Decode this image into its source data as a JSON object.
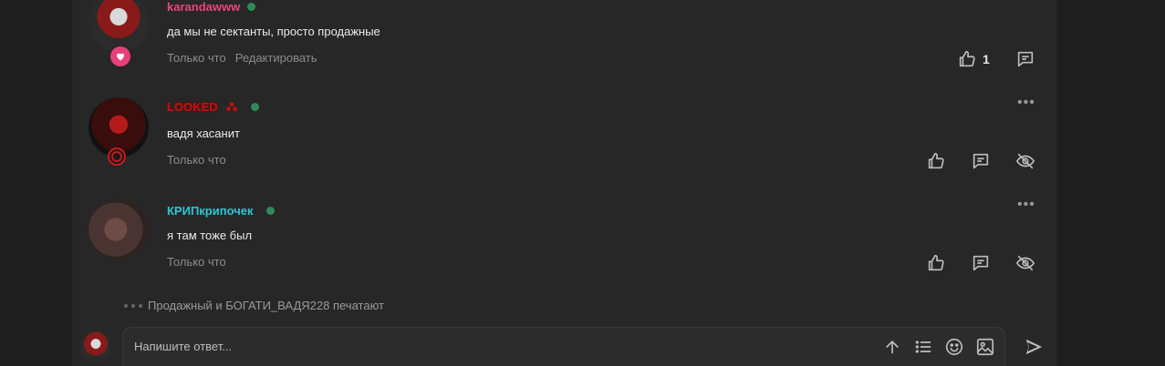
{
  "comments": [
    {
      "username": "karandawww",
      "text": "да мы не сектанты, просто продажные",
      "time": "Только что",
      "edit_label": "Редактировать",
      "likes": "1",
      "badge": "heart-badge",
      "colors": {
        "username": "#e8457d",
        "online": "#2e8b57"
      }
    },
    {
      "username": "LOOKED",
      "text": "вадя хасанит",
      "time": "Только что",
      "badge": "ring-badge",
      "colors": {
        "username": "#c41010",
        "online": "#2e8b57"
      }
    },
    {
      "username": "КРИПкрипочек",
      "text": "я там тоже был",
      "time": "Только что",
      "colors": {
        "username": "#2ec4d6",
        "online": "#2e8b57"
      }
    }
  ],
  "typing": {
    "text": "Продажный и БОГАТИ_ВАДЯ228 печатают"
  },
  "reply": {
    "placeholder": "Напишите ответ..."
  },
  "icons": {
    "more": "more-dots-icon",
    "like": "thumbs-up-icon",
    "reply": "comment-icon",
    "hide": "eye-off-icon",
    "toolbar": [
      "arrow-up-icon",
      "list-icon",
      "emoji-icon",
      "image-icon"
    ],
    "send": "send-icon"
  }
}
